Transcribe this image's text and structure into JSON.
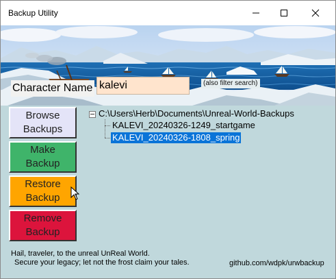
{
  "window": {
    "title": "Backup Utility"
  },
  "search": {
    "label": "Character Name",
    "value": "kalevi",
    "hint": "(also filter search)"
  },
  "buttons": {
    "browse": {
      "label": "Browse\nBackups",
      "color": "#e4e4f8"
    },
    "make": {
      "label": "Make\nBackup",
      "color": "#3fb46a"
    },
    "restore": {
      "label": "Restore\nBackup",
      "color": "#ffa500"
    },
    "remove": {
      "label": "Remove\nBackup",
      "color": "#dc143c"
    }
  },
  "tree": {
    "root": "C:\\Users\\Herb\\Documents\\Unreal-World-Backups",
    "items": [
      {
        "label": "KALEVI_20240326-1249_startgame",
        "selected": false
      },
      {
        "label": "KALEVI_20240326-1808_spring",
        "selected": true
      }
    ],
    "selection_color": "#0a74d8"
  },
  "footer": {
    "line1": "Hail, traveler, to the unreal UnReal World.",
    "line2": "Secure your legacy; let not the frost claim your tales.",
    "link": "github.com/wdpk/urwbackup"
  },
  "icons": [
    "minimize-icon",
    "maximize-icon",
    "close-icon",
    "collapse-icon",
    "mouse-cursor-icon"
  ]
}
